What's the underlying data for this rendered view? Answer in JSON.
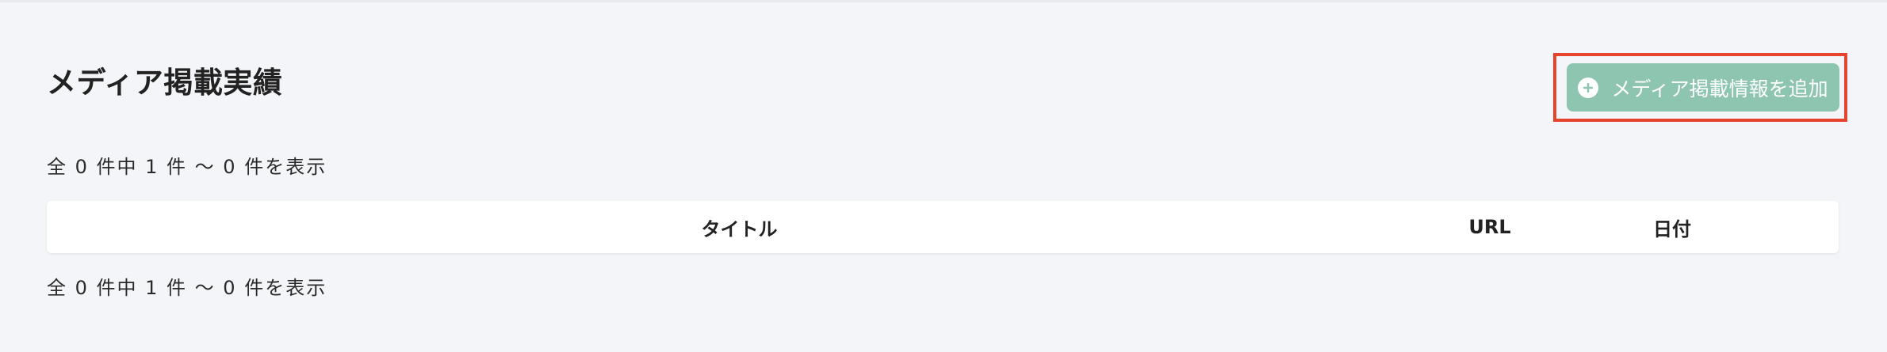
{
  "header": {
    "title": "メディア掲載実績",
    "add_button_label": "メディア掲載情報を追加",
    "add_button_icon": "plus-circle-icon"
  },
  "pagination": {
    "summary_top": "全 0 件中 1 件 〜 0 件を表示",
    "summary_bottom": "全 0 件中 1 件 〜 0 件を表示"
  },
  "table": {
    "columns": [
      "タイトル",
      "URL",
      "日付"
    ],
    "rows": []
  },
  "colors": {
    "background": "#f4f5f8",
    "accent_button": "#8dc5b1",
    "highlight_border": "#e6442d"
  }
}
